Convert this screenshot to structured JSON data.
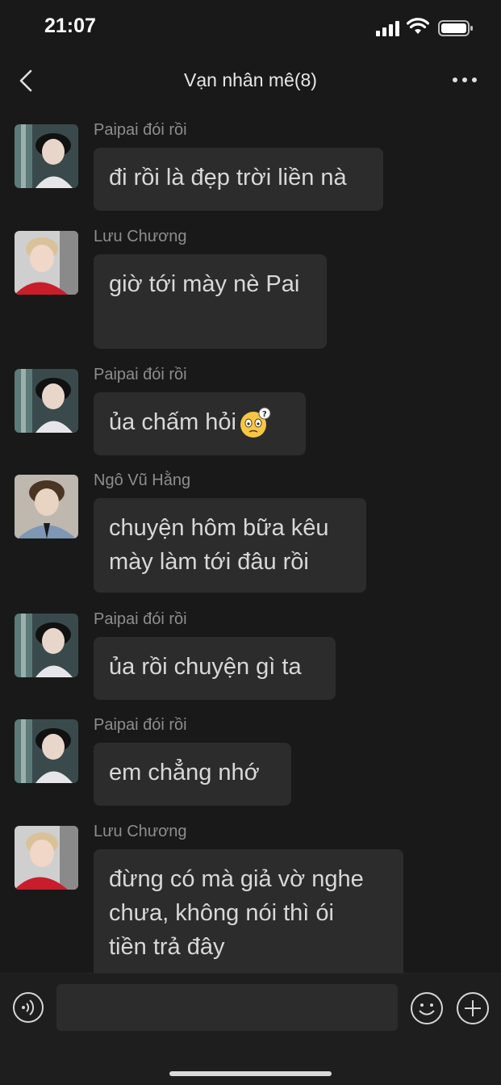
{
  "status_bar": {
    "time": "21:07"
  },
  "nav": {
    "title": "Vạn nhân mê(8)"
  },
  "messages": [
    {
      "sender": "Paipai đói rồi",
      "lines": [
        "đi rồi là đẹp trời liền nà"
      ],
      "avatar": "avatar-paipai"
    },
    {
      "sender": "Lưu Chương",
      "lines": [
        "giờ tới mày nè Pai",
        " "
      ],
      "avatar": "avatar-luu-chuong"
    },
    {
      "sender": "Paipai đói rồi",
      "lines": [
        "ủa chấm hỏi"
      ],
      "emoji": "confused-face-emoji",
      "avatar": "avatar-paipai"
    },
    {
      "sender": "Ngô Vũ Hằng",
      "lines": [
        "chuyện hôm bữa kêu",
        "mày làm tới đâu rồi"
      ],
      "avatar": "avatar-ngo-vu-hang"
    },
    {
      "sender": "Paipai đói rồi",
      "lines": [
        "ủa rồi chuyện gì ta"
      ],
      "avatar": "avatar-paipai"
    },
    {
      "sender": "Paipai đói rồi",
      "lines": [
        "em chẳng nhớ"
      ],
      "avatar": "avatar-paipai"
    },
    {
      "sender": "Lưu Chương",
      "lines": [
        "đừng có mà giả vờ nghe",
        "chưa, không nói thì ói",
        "tiền trả đây"
      ],
      "avatar": "avatar-luu-chuong"
    }
  ],
  "input_bar": {
    "icons": [
      "voice-icon",
      "emoji-icon",
      "add-icon"
    ]
  },
  "colors": {
    "background": "#191919",
    "bubble": "#2c2c2c",
    "text": "#d8d8d8",
    "sender": "#8d8d8d"
  }
}
